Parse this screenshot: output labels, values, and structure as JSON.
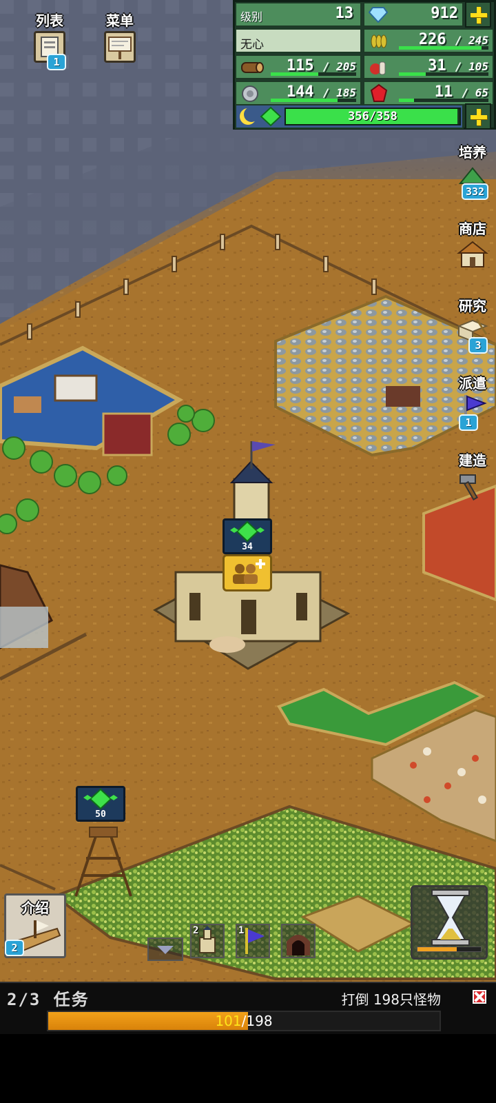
{
  "top_left": {
    "list": {
      "label": "列表",
      "badge": "1"
    },
    "menu": {
      "label": "菜单"
    }
  },
  "status": {
    "level_label": "级别",
    "level": "13",
    "gems": "912",
    "player_name": "无心",
    "food": {
      "value": "226",
      "max": "245",
      "fill": 0.92
    },
    "wood": {
      "value": "115",
      "max": "205",
      "fill": 0.56
    },
    "crops": {
      "value": "31",
      "max": "105",
      "fill": 0.3
    },
    "ore": {
      "value": "144",
      "max": "185",
      "fill": 0.78
    },
    "ruby": {
      "value": "11",
      "max": "65",
      "fill": 0.17
    },
    "energy": {
      "value": "356",
      "max": "358",
      "fill": 0.99
    }
  },
  "side_buttons": {
    "train": {
      "label": "培养",
      "badge": "332"
    },
    "shop": {
      "label": "商店"
    },
    "research": {
      "label": "研究",
      "badge": "3"
    },
    "dispatch": {
      "label": "派遣",
      "badge": "1"
    },
    "build": {
      "label": "建造"
    }
  },
  "map_markers": {
    "town_hall_gems": "34",
    "tower_gems": "50"
  },
  "bottom_hud": {
    "intro": {
      "label": "介绍",
      "badge": "2"
    },
    "building_slot_count": "2",
    "flag_slot_count": "1"
  },
  "mission": {
    "count": "2/3",
    "label": "任务",
    "goal": "打倒 198只怪物",
    "current": "101",
    "separator": "/",
    "total": "198",
    "progress": 0.51
  },
  "colors": {
    "ground": "#a8742e",
    "panel": "#4d8d5c",
    "bar": "#3ae04a",
    "mission_fill": "#f2a21a"
  }
}
